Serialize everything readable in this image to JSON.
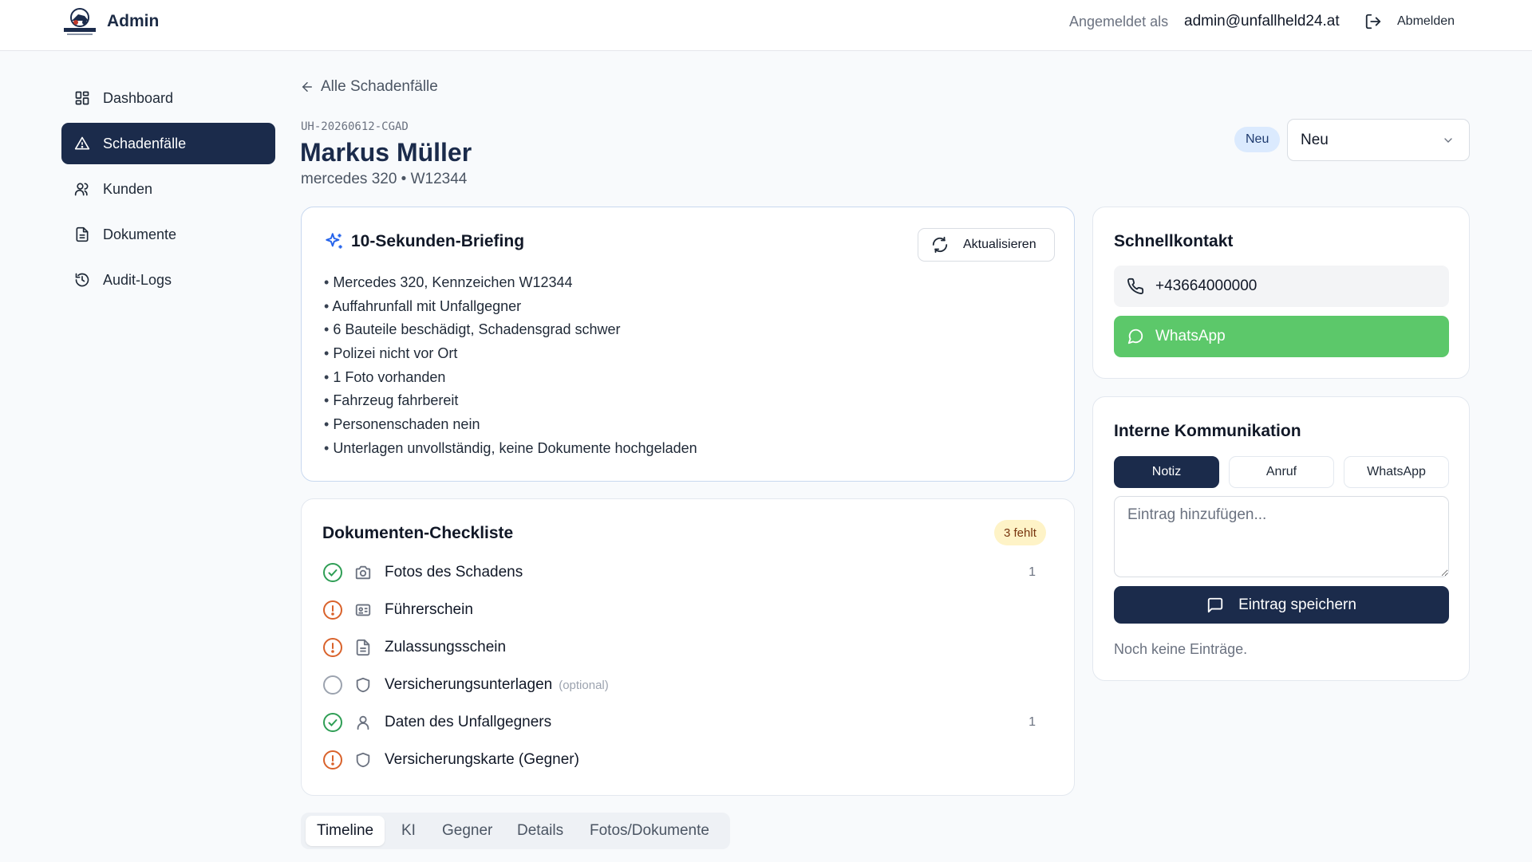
{
  "header": {
    "app_title": "Admin",
    "logo_icon": "unfallheld-logo",
    "signed_in_label": "Angemeldet als",
    "signed_in_email": "admin@unfallheld24.at",
    "logout_label": "Abmelden"
  },
  "sidebar": {
    "items": [
      {
        "label": "Dashboard",
        "icon": "dashboard-icon",
        "active": false
      },
      {
        "label": "Schadenfälle",
        "icon": "warning-triangle-icon",
        "active": true
      },
      {
        "label": "Kunden",
        "icon": "users-icon",
        "active": false
      },
      {
        "label": "Dokumente",
        "icon": "document-icon",
        "active": false
      },
      {
        "label": "Audit-Logs",
        "icon": "history-icon",
        "active": false
      }
    ]
  },
  "case": {
    "back_label": "Alle Schadenfälle",
    "id": "UH-20260612-CGAD",
    "name": "Markus Müller",
    "vehicle": "mercedes 320 • W12344",
    "status_badge": "Neu",
    "status_select": "Neu"
  },
  "briefing": {
    "title": "10-Sekunden-Briefing",
    "refresh_label": "Aktualisieren",
    "items": [
      "Mercedes 320, Kennzeichen W12344",
      "Auffahrunfall mit Unfallgegner",
      "6 Bauteile beschädigt, Schadensgrad schwer",
      "Polizei nicht vor Ort",
      "1 Foto vorhanden",
      "Fahrzeug fahrbereit",
      "Personenschaden nein",
      "Unterlagen unvollständig, keine Dokumente hochgeladen"
    ]
  },
  "checklist": {
    "title": "Dokumenten-Checkliste",
    "missing_badge": "3 fehlt",
    "items": [
      {
        "label": "Fotos des Schadens",
        "status": "complete",
        "icon": "camera-icon",
        "count": "1",
        "optional": ""
      },
      {
        "label": "Führerschein",
        "status": "missing",
        "icon": "id-card-icon",
        "count": "",
        "optional": ""
      },
      {
        "label": "Zulassungsschein",
        "status": "missing",
        "icon": "document-icon",
        "count": "",
        "optional": ""
      },
      {
        "label": "Versicherungsunterlagen",
        "status": "pending",
        "icon": "shield-icon",
        "count": "",
        "optional": "(optional)"
      },
      {
        "label": "Daten des Unfallgegners",
        "status": "complete",
        "icon": "user-icon",
        "count": "1",
        "optional": ""
      },
      {
        "label": "Versicherungskarte (Gegner)",
        "status": "missing",
        "icon": "shield-icon",
        "count": "",
        "optional": ""
      }
    ],
    "colors": {
      "complete": "#2f9e55",
      "missing": "#d9622b",
      "pending": "#9ca3af"
    }
  },
  "tabs": [
    {
      "label": "Timeline",
      "active": true
    },
    {
      "label": "KI",
      "active": false
    },
    {
      "label": "Gegner",
      "active": false
    },
    {
      "label": "Details",
      "active": false
    },
    {
      "label": "Fotos/Dokumente",
      "active": false
    }
  ],
  "quick_contact": {
    "title": "Schnellkontakt",
    "phone": "+43664000000",
    "whatsapp_label": "WhatsApp"
  },
  "internal_comm": {
    "title": "Interne Kommunikation",
    "segments": [
      {
        "label": "Notiz",
        "active": true
      },
      {
        "label": "Anruf",
        "active": false
      },
      {
        "label": "WhatsApp",
        "active": false
      }
    ],
    "input_placeholder": "Eintrag hinzufügen...",
    "save_label": "Eintrag speichern",
    "empty_text": "Noch keine Einträge."
  },
  "colors": {
    "primary": "#1b2b4b",
    "whatsapp": "#5cc86a",
    "badge_blue": "#dbeafe",
    "badge_amber": "#fef3c7"
  }
}
